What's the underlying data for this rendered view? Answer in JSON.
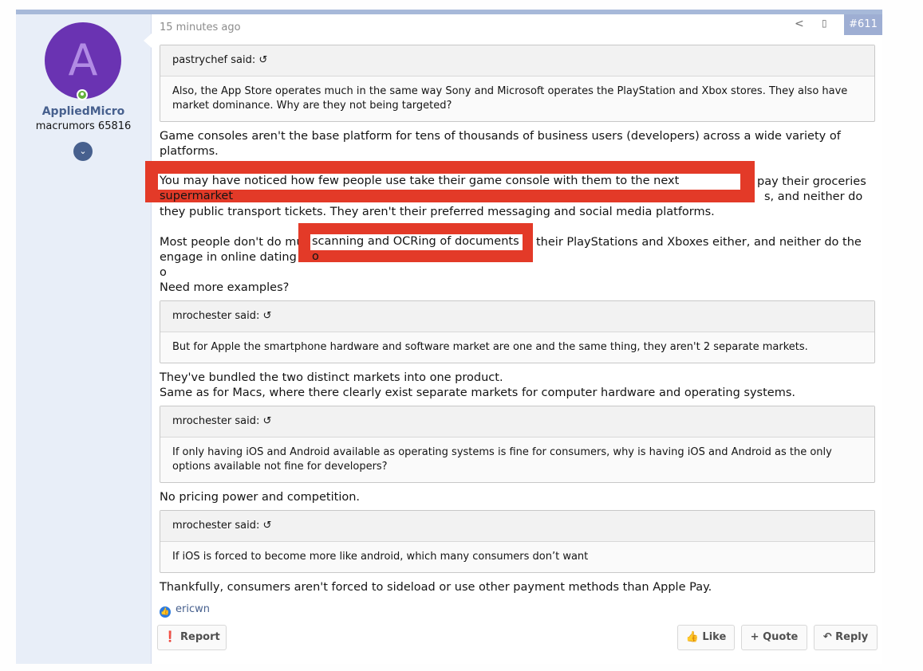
{
  "user": {
    "avatar_letter": "A",
    "name": "AppliedMicro",
    "title": "macrumors 65816",
    "expand_icon": "chevron-down-icon"
  },
  "post": {
    "timestamp": "15 minutes ago",
    "number": "#611",
    "share_icon": "share-icon",
    "bookmark_icon": "bookmark-icon"
  },
  "quotes": [
    {
      "author": "pastrychef said:",
      "text": "Also, the App Store operates much in the same way Sony and Microsoft operates the PlayStation and Xbox stores. They also have market dominance. Why are they not being targeted?"
    },
    {
      "author": "mrochester said:",
      "text": "But for Apple the smartphone hardware and software market are one and the same thing, they aren't 2 separate markets."
    },
    {
      "author": "mrochester said:",
      "text": "If only having iOS and Android available as operating systems is fine for consumers, why is having iOS and Android as the only options available not fine for developers?"
    },
    {
      "author": "mrochester said:",
      "text": "If iOS is forced to become more like android, which many consumers don’t want"
    }
  ],
  "body": {
    "p1": "Game consoles aren't the base platform for tens of thousands of business users (developers) across a wide variety of platforms.",
    "p2_right1": "pay their groceries",
    "p2_right2": "s, and neither do",
    "p2_line3": "they public transport tickets. They aren't their preferred messaging and social media platforms.",
    "p3_start": "Most people don't do mu",
    "p3_right": "their PlayStations and Xboxes either, and neither do the",
    "p3_line2": "engage in online dating o",
    "p4": "Need more examples?",
    "p5_line1": "They've bundled the two distinct markets into one product.",
    "p5_line2": "Same as for Macs, where there clearly exist separate markets for computer hardware and operating systems.",
    "p6": "No pricing power and competition.",
    "p7": "Thankfully, consumers aren't forced to sideload or use other payment methods than Apple Pay."
  },
  "highlights": {
    "h1": "You may have noticed how few people use take their game console with them to the next supermarket",
    "h2": "scanning and OCRing of documents o"
  },
  "reactions": {
    "icon": "like-icon",
    "users": "ericwn"
  },
  "actions": {
    "report": "Report",
    "like": "Like",
    "quote": "Quote",
    "reply": "Reply"
  },
  "colors": {
    "accent": "#47608e",
    "highlight_box": "#e33a28",
    "avatar_bg": "#6a33b2"
  }
}
